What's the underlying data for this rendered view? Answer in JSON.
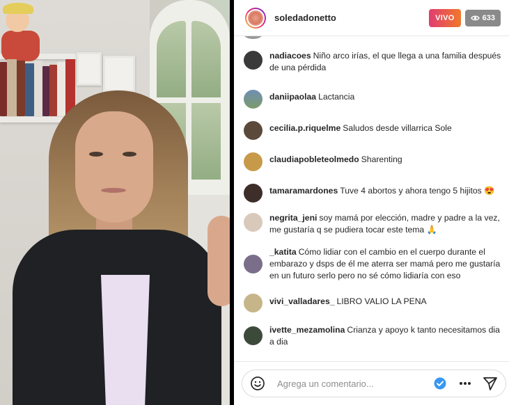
{
  "header": {
    "username": "soledadonetto",
    "live_label": "VIVO",
    "viewer_count": "633"
  },
  "colors": {
    "live_gradient_start": "#e13c72",
    "live_gradient_end": "#f0782a",
    "viewer_badge": "#8a8a8a",
    "verified_blue": "#3897f0"
  },
  "comments": [
    {
      "username": "nadiacoes",
      "text": "Niño arco irías, el que llega a una familia después de una pérdida",
      "avatar_color": "#3a3a3a"
    },
    {
      "username": "daniipaolaa",
      "text": "Lactancia",
      "avatar_color": "#6f8fb5"
    },
    {
      "username": "cecilia.p.riquelme",
      "text": "Saludos desde villarrica Sole",
      "avatar_color": "#5b4a3c"
    },
    {
      "username": "claudiapobleteolmedo",
      "text": "Sharenting",
      "avatar_color": "#c79a4a"
    },
    {
      "username": "tamaramardones",
      "text": "Tuve 4 abortos y ahora tengo 5 hijitos 😍",
      "avatar_color": "#3d2e2a"
    },
    {
      "username": "negrita_jeni",
      "text": "soy mamá por elección, madre y padre a la vez, me gustaría q se pudiera tocar este tema 🙏",
      "avatar_color": "#d9c9bb"
    },
    {
      "username": "_katita",
      "text": "Cómo lidiar con el cambio en el cuerpo durante el embarazo y dsps de él me aterra ser mamá pero me gustaría en un futuro serlo pero no sé cómo lidiaría con eso",
      "avatar_color": "#7a6f8a"
    },
    {
      "username": "vivi_valladares_",
      "text": "LIBRO VALIO LA PENA",
      "avatar_color": "#c7b58a"
    },
    {
      "username": "ivette_mezamolina",
      "text": "Crianza y apoyo k tanto necesitamos dia a dia",
      "avatar_color": "#3c4a3a"
    }
  ],
  "footer": {
    "placeholder": "Agrega un comentario...",
    "emoji_icon": "smiley-icon",
    "verified_icon": "verified-check-icon",
    "more_icon": "more-dots-icon",
    "send_icon": "paper-plane-icon"
  }
}
